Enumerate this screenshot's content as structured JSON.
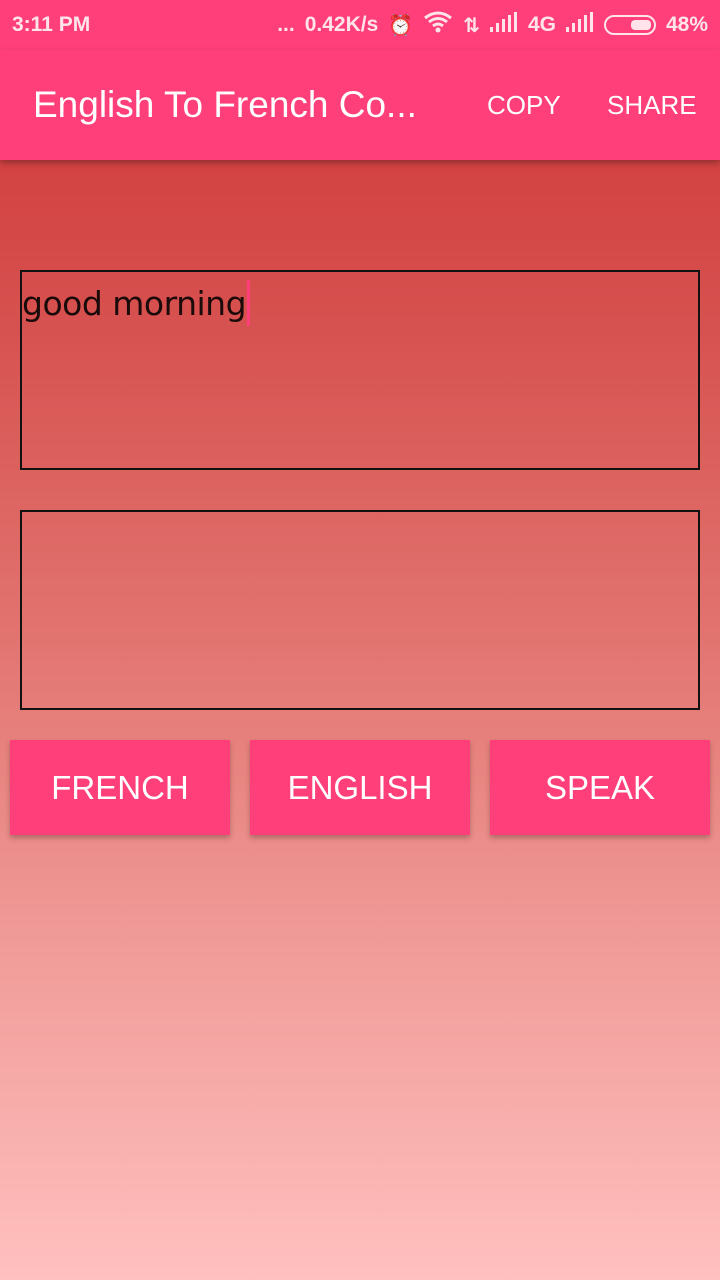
{
  "status_bar": {
    "time": "3:11 PM",
    "dots": "...",
    "network_speed": "0.42K/s",
    "alarm_icon": "alarm-icon",
    "wifi_icon": "wifi-icon",
    "data_icon": "data-transfer-icon",
    "signal1_icon": "signal-icon",
    "network_type": "4G",
    "signal2_icon": "signal-icon",
    "battery_percent": "48%",
    "battery_level": 0.48
  },
  "app_bar": {
    "title": "English To French Co...",
    "actions": [
      {
        "label": "COPY"
      },
      {
        "label": "SHARE"
      }
    ]
  },
  "main": {
    "input_text": "good morning",
    "output_text": "",
    "buttons": [
      {
        "label": "FRENCH"
      },
      {
        "label": "ENGLISH"
      },
      {
        "label": "SPEAK"
      }
    ]
  },
  "colors": {
    "accent": "#ff3f7a",
    "gradient_top": "#cf3336",
    "gradient_bottom": "#ffc0bf"
  }
}
